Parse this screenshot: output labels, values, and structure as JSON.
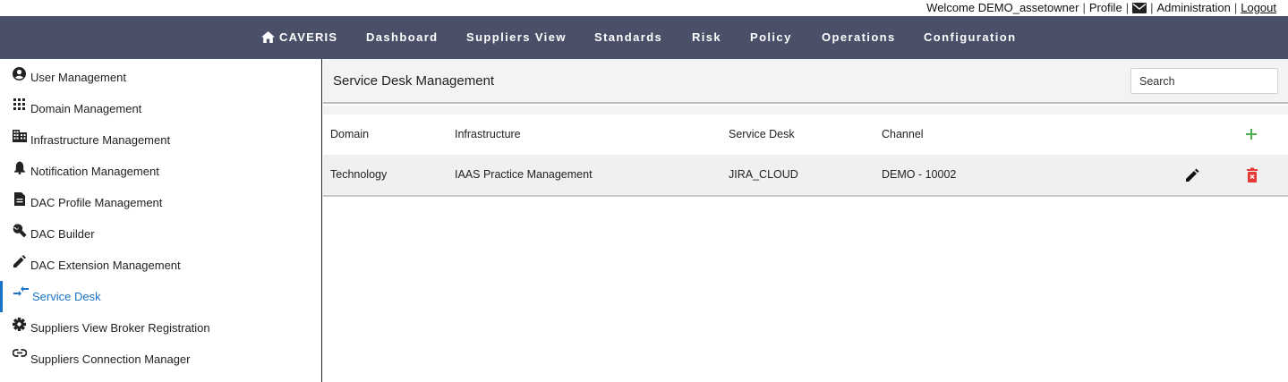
{
  "topbar": {
    "welcome": "Welcome DEMO_assetowner",
    "profile": "Profile",
    "administration": "Administration",
    "logout": "Logout",
    "separator": "|"
  },
  "nav": {
    "brand": "CAVERIS",
    "items": [
      "Dashboard",
      "Suppliers View",
      "Standards",
      "Risk",
      "Policy",
      "Operations",
      "Configuration"
    ]
  },
  "sidebar": {
    "active_index": 7,
    "items": [
      {
        "label": "User Management",
        "icon": "account-circle-icon"
      },
      {
        "label": "Domain Management",
        "icon": "apps-grid-icon"
      },
      {
        "label": "Infrastructure Management",
        "icon": "building-icon"
      },
      {
        "label": "Notification Management",
        "icon": "bell-icon"
      },
      {
        "label": "DAC Profile Management",
        "icon": "document-icon"
      },
      {
        "label": "DAC Builder",
        "icon": "wrench-icon"
      },
      {
        "label": "DAC Extension Management",
        "icon": "pencil-icon"
      },
      {
        "label": "Service Desk",
        "icon": "compare-arrows-icon"
      },
      {
        "label": "Suppliers View Broker Registration",
        "icon": "gear-icon"
      },
      {
        "label": "Suppliers Connection Manager",
        "icon": "link-icon"
      }
    ]
  },
  "main": {
    "title": "Service Desk Management",
    "search_placeholder": "Search",
    "columns": [
      "Domain",
      "Infrastructure",
      "Service Desk",
      "Channel"
    ],
    "rows": [
      {
        "domain": "Technology",
        "infrastructure": "IAAS Practice Management",
        "service_desk": "JIRA_CLOUD",
        "channel": "DEMO - 10002"
      }
    ]
  },
  "colors": {
    "navbar_bg": "#4a5068",
    "active_accent": "#1a73c8",
    "add_green": "#4caf50",
    "delete_red": "#e53935"
  }
}
